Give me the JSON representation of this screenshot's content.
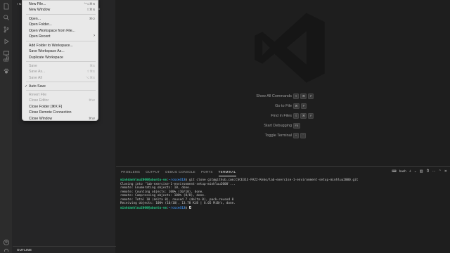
{
  "sidebar": {
    "header": "CS",
    "outline": "OUTLINE",
    "peek_count": "0"
  },
  "activity_icons": [
    "files-icon",
    "search-icon",
    "source-control-icon",
    "run-debug-icon",
    "remote-explorer-icon",
    "extensions-icon",
    "paw-icon",
    "account-icon",
    "settings-gear-icon"
  ],
  "file_menu": {
    "items": [
      {
        "label": "New File...",
        "shortcut": "^⌥⌘N",
        "enabled": true
      },
      {
        "label": "New Window",
        "shortcut": "⇧⌘N",
        "enabled": true
      },
      {
        "label": "Open...",
        "shortcut": "⌘O",
        "enabled": true
      },
      {
        "label": "Open Folder...",
        "shortcut": "",
        "enabled": true
      },
      {
        "label": "Open Workspace from File...",
        "shortcut": "",
        "enabled": true
      },
      {
        "label": "Open Recent",
        "shortcut": "",
        "enabled": true,
        "submenu": true
      },
      {
        "label": "Add Folder to Workspace...",
        "shortcut": "",
        "enabled": true
      },
      {
        "label": "Save Workspace As...",
        "shortcut": "",
        "enabled": true
      },
      {
        "label": "Duplicate Workspace",
        "shortcut": "",
        "enabled": true
      },
      {
        "label": "Save",
        "shortcut": "⌘S",
        "enabled": false
      },
      {
        "label": "Save As...",
        "shortcut": "⇧⌘S",
        "enabled": false
      },
      {
        "label": "Save All",
        "shortcut": "⌥⌘S",
        "enabled": false
      },
      {
        "label": "Auto Save",
        "shortcut": "",
        "enabled": true,
        "checked": true
      },
      {
        "label": "Revert File",
        "shortcut": "",
        "enabled": false
      },
      {
        "label": "Close Editor",
        "shortcut": "⌘W",
        "enabled": false
      },
      {
        "label": "Close Folder [⌘K F]",
        "shortcut": "",
        "enabled": true
      },
      {
        "label": "Close Remote Connection",
        "shortcut": "",
        "enabled": true
      },
      {
        "label": "Close Window",
        "shortcut": "⌘W",
        "enabled": true
      }
    ]
  },
  "editor": {
    "shortcuts": [
      {
        "label": "Show All Commands",
        "keys": [
          "⇧",
          "⌘",
          "P"
        ]
      },
      {
        "label": "Go to File",
        "keys": [
          "⌘",
          "P"
        ]
      },
      {
        "label": "Find in Files",
        "keys": [
          "⇧",
          "⌘",
          "F"
        ]
      },
      {
        "label": "Start Debugging",
        "keys": [
          "F5"
        ]
      },
      {
        "label": "Toggle Terminal",
        "keys": [
          "^",
          "`"
        ]
      }
    ]
  },
  "panel": {
    "tabs": [
      "PROBLEMS",
      "OUTPUT",
      "DEBUG CONSOLE",
      "PORTS",
      "TERMINAL"
    ],
    "active_tab": "TERMINAL",
    "terminal_name": "bash",
    "tools": [
      "+",
      "⌄",
      "▥",
      "🗑",
      "···",
      "⌃",
      "✕"
    ],
    "terminal": {
      "prompt_user": "minhdanhluu2000@ubuntu-vm",
      "prompt_path": "~/csce313",
      "command": "git clone git@github.com:CSCE313-FA22-Kebo/lab-exercise-1-environment-setup-minhluu2000.git",
      "output": [
        "Cloning into 'lab-exercise-1-environment-setup-minhluu2000'...",
        "remote: Enumerating objects: 10, done.",
        "remote: Counting objects: 100% (10/10), done.",
        "remote: Compressing objects: 100% (8/8), done.",
        "remote: Total 10 (delta 0), reused 7 (delta 0), pack-reused 0",
        "Receiving objects: 100% (10/10), 13.78 KiB | 6.05 MiB/s, done."
      ]
    }
  },
  "colors": {
    "editor_bg": "#1e1e1e",
    "sidebar_bg": "#252526",
    "menu_bg": "#e9e9e9",
    "prompt_green": "#23d18b",
    "path_blue": "#3b8eea"
  }
}
